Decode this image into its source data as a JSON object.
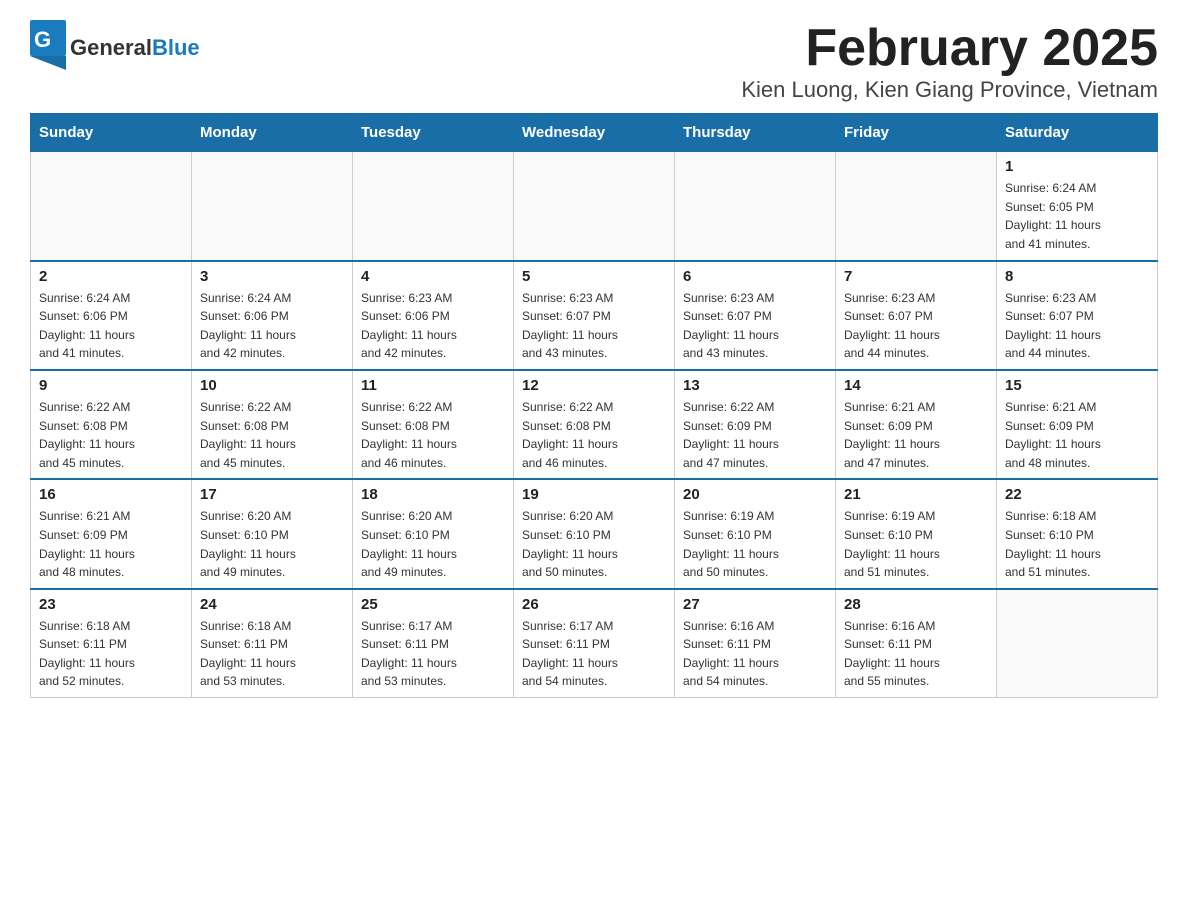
{
  "header": {
    "logo_general": "General",
    "logo_blue": "Blue",
    "title": "February 2025",
    "subtitle": "Kien Luong, Kien Giang Province, Vietnam"
  },
  "weekdays": [
    "Sunday",
    "Monday",
    "Tuesday",
    "Wednesday",
    "Thursday",
    "Friday",
    "Saturday"
  ],
  "weeks": [
    [
      {
        "day": "",
        "info": ""
      },
      {
        "day": "",
        "info": ""
      },
      {
        "day": "",
        "info": ""
      },
      {
        "day": "",
        "info": ""
      },
      {
        "day": "",
        "info": ""
      },
      {
        "day": "",
        "info": ""
      },
      {
        "day": "1",
        "info": "Sunrise: 6:24 AM\nSunset: 6:05 PM\nDaylight: 11 hours\nand 41 minutes."
      }
    ],
    [
      {
        "day": "2",
        "info": "Sunrise: 6:24 AM\nSunset: 6:06 PM\nDaylight: 11 hours\nand 41 minutes."
      },
      {
        "day": "3",
        "info": "Sunrise: 6:24 AM\nSunset: 6:06 PM\nDaylight: 11 hours\nand 42 minutes."
      },
      {
        "day": "4",
        "info": "Sunrise: 6:23 AM\nSunset: 6:06 PM\nDaylight: 11 hours\nand 42 minutes."
      },
      {
        "day": "5",
        "info": "Sunrise: 6:23 AM\nSunset: 6:07 PM\nDaylight: 11 hours\nand 43 minutes."
      },
      {
        "day": "6",
        "info": "Sunrise: 6:23 AM\nSunset: 6:07 PM\nDaylight: 11 hours\nand 43 minutes."
      },
      {
        "day": "7",
        "info": "Sunrise: 6:23 AM\nSunset: 6:07 PM\nDaylight: 11 hours\nand 44 minutes."
      },
      {
        "day": "8",
        "info": "Sunrise: 6:23 AM\nSunset: 6:07 PM\nDaylight: 11 hours\nand 44 minutes."
      }
    ],
    [
      {
        "day": "9",
        "info": "Sunrise: 6:22 AM\nSunset: 6:08 PM\nDaylight: 11 hours\nand 45 minutes."
      },
      {
        "day": "10",
        "info": "Sunrise: 6:22 AM\nSunset: 6:08 PM\nDaylight: 11 hours\nand 45 minutes."
      },
      {
        "day": "11",
        "info": "Sunrise: 6:22 AM\nSunset: 6:08 PM\nDaylight: 11 hours\nand 46 minutes."
      },
      {
        "day": "12",
        "info": "Sunrise: 6:22 AM\nSunset: 6:08 PM\nDaylight: 11 hours\nand 46 minutes."
      },
      {
        "day": "13",
        "info": "Sunrise: 6:22 AM\nSunset: 6:09 PM\nDaylight: 11 hours\nand 47 minutes."
      },
      {
        "day": "14",
        "info": "Sunrise: 6:21 AM\nSunset: 6:09 PM\nDaylight: 11 hours\nand 47 minutes."
      },
      {
        "day": "15",
        "info": "Sunrise: 6:21 AM\nSunset: 6:09 PM\nDaylight: 11 hours\nand 48 minutes."
      }
    ],
    [
      {
        "day": "16",
        "info": "Sunrise: 6:21 AM\nSunset: 6:09 PM\nDaylight: 11 hours\nand 48 minutes."
      },
      {
        "day": "17",
        "info": "Sunrise: 6:20 AM\nSunset: 6:10 PM\nDaylight: 11 hours\nand 49 minutes."
      },
      {
        "day": "18",
        "info": "Sunrise: 6:20 AM\nSunset: 6:10 PM\nDaylight: 11 hours\nand 49 minutes."
      },
      {
        "day": "19",
        "info": "Sunrise: 6:20 AM\nSunset: 6:10 PM\nDaylight: 11 hours\nand 50 minutes."
      },
      {
        "day": "20",
        "info": "Sunrise: 6:19 AM\nSunset: 6:10 PM\nDaylight: 11 hours\nand 50 minutes."
      },
      {
        "day": "21",
        "info": "Sunrise: 6:19 AM\nSunset: 6:10 PM\nDaylight: 11 hours\nand 51 minutes."
      },
      {
        "day": "22",
        "info": "Sunrise: 6:18 AM\nSunset: 6:10 PM\nDaylight: 11 hours\nand 51 minutes."
      }
    ],
    [
      {
        "day": "23",
        "info": "Sunrise: 6:18 AM\nSunset: 6:11 PM\nDaylight: 11 hours\nand 52 minutes."
      },
      {
        "day": "24",
        "info": "Sunrise: 6:18 AM\nSunset: 6:11 PM\nDaylight: 11 hours\nand 53 minutes."
      },
      {
        "day": "25",
        "info": "Sunrise: 6:17 AM\nSunset: 6:11 PM\nDaylight: 11 hours\nand 53 minutes."
      },
      {
        "day": "26",
        "info": "Sunrise: 6:17 AM\nSunset: 6:11 PM\nDaylight: 11 hours\nand 54 minutes."
      },
      {
        "day": "27",
        "info": "Sunrise: 6:16 AM\nSunset: 6:11 PM\nDaylight: 11 hours\nand 54 minutes."
      },
      {
        "day": "28",
        "info": "Sunrise: 6:16 AM\nSunset: 6:11 PM\nDaylight: 11 hours\nand 55 minutes."
      },
      {
        "day": "",
        "info": ""
      }
    ]
  ]
}
